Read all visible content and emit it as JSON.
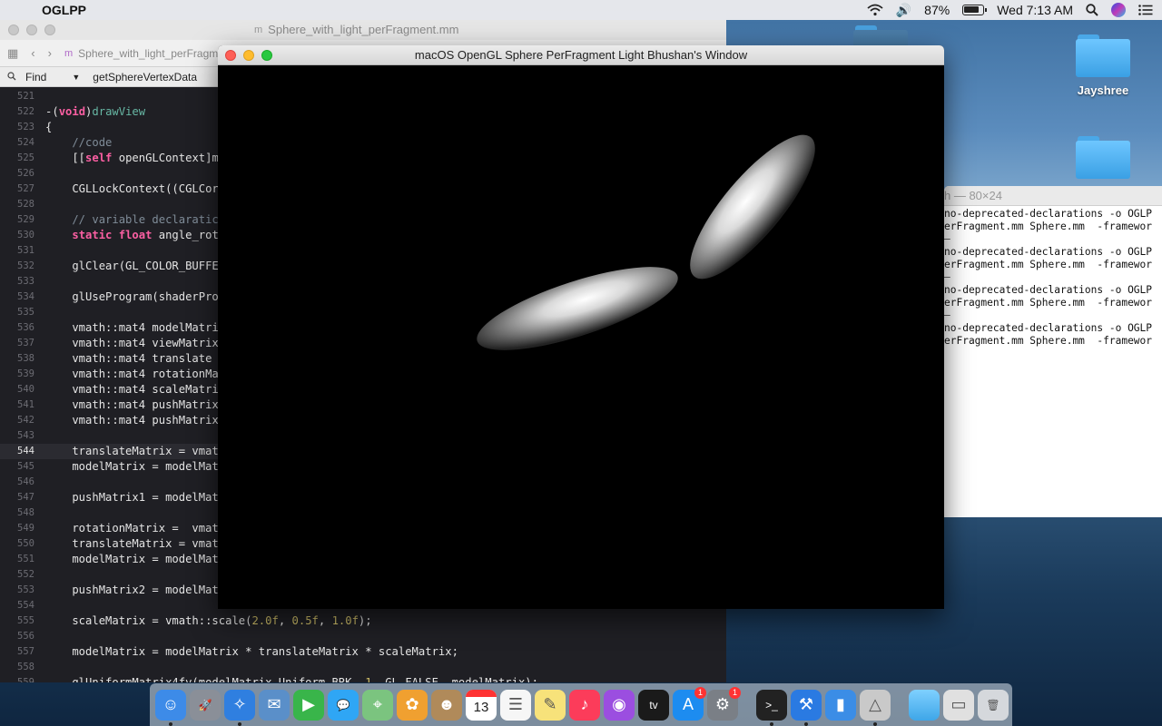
{
  "menubar": {
    "app_name": "OGLPP",
    "battery_percent": "87%",
    "clock": "Wed 7:13 AM"
  },
  "desktop": {
    "items": [
      {
        "label": "Jayshree"
      },
      {
        "label": ""
      },
      {
        "label": ""
      }
    ]
  },
  "xcode": {
    "title": "Sphere_with_light_perFragment.mm",
    "breadcrumb_file": "Sphere_with_light_perFragm",
    "find_mode": "Find",
    "find_query": "getSphereVertexData",
    "lines": [
      {
        "n": "521",
        "t": ""
      },
      {
        "n": "522",
        "t": "-(void)drawView"
      },
      {
        "n": "523",
        "t": "{"
      },
      {
        "n": "524",
        "t": "    //code"
      },
      {
        "n": "525",
        "t": "    [[self openGLContext]m"
      },
      {
        "n": "526",
        "t": ""
      },
      {
        "n": "527",
        "t": "    CGLLockContext((CGLCor"
      },
      {
        "n": "528",
        "t": ""
      },
      {
        "n": "529",
        "t": "    // variable declaratic"
      },
      {
        "n": "530",
        "t": "    static float angle_rot"
      },
      {
        "n": "531",
        "t": ""
      },
      {
        "n": "532",
        "t": "    glClear(GL_COLOR_BUFFE"
      },
      {
        "n": "533",
        "t": ""
      },
      {
        "n": "534",
        "t": "    glUseProgram(shaderPro"
      },
      {
        "n": "535",
        "t": ""
      },
      {
        "n": "536",
        "t": "    vmath::mat4 modelMatri"
      },
      {
        "n": "537",
        "t": "    vmath::mat4 viewMatrix"
      },
      {
        "n": "538",
        "t": "    vmath::mat4 translate"
      },
      {
        "n": "539",
        "t": "    vmath::mat4 rotationMa"
      },
      {
        "n": "540",
        "t": "    vmath::mat4 scaleMatri"
      },
      {
        "n": "541",
        "t": "    vmath::mat4 pushMatrix"
      },
      {
        "n": "542",
        "t": "    vmath::mat4 pushMatrix"
      },
      {
        "n": "543",
        "t": ""
      },
      {
        "n": "544",
        "t": "    translateMatrix = vmat"
      },
      {
        "n": "545",
        "t": "    modelMatrix = modelMat"
      },
      {
        "n": "546",
        "t": ""
      },
      {
        "n": "547",
        "t": "    pushMatrix1 = modelMat"
      },
      {
        "n": "548",
        "t": ""
      },
      {
        "n": "549",
        "t": "    rotationMatrix =  vmat"
      },
      {
        "n": "550",
        "t": "    translateMatrix = vmat"
      },
      {
        "n": "551",
        "t": "    modelMatrix = modelMat"
      },
      {
        "n": "552",
        "t": ""
      },
      {
        "n": "553",
        "t": "    pushMatrix2 = modelMat"
      },
      {
        "n": "554",
        "t": ""
      },
      {
        "n": "555",
        "t": "    scaleMatrix = vmath::scale(2.0f, 0.5f, 1.0f);"
      },
      {
        "n": "556",
        "t": ""
      },
      {
        "n": "557",
        "t": "    modelMatrix = modelMatrix * translateMatrix * scaleMatrix;"
      },
      {
        "n": "558",
        "t": ""
      },
      {
        "n": "559",
        "t": "    glUniformMatrix4fv(modelMatrix_Uniform_BRK, 1, GL_FALSE, modelMatrix);"
      }
    ],
    "current_line": "544"
  },
  "glwindow": {
    "title": "macOS OpenGL Sphere PerFragment Light Bhushan's Window"
  },
  "terminal": {
    "title": "h — 80×24",
    "lines": [
      "no-deprecated-declarations -o OGLP",
      "erFragment.mm Sphere.mm  -framewor",
      "",
      "no-deprecated-declarations -o OGLP",
      "erFragment.mm Sphere.mm  -framewor",
      "",
      "no-deprecated-declarations -o OGLP",
      "erFragment.mm Sphere.mm  -framewor",
      "",
      "no-deprecated-declarations -o OGLP",
      "erFragment.mm Sphere.mm  -framewor"
    ]
  },
  "dock": {
    "calendar_day": "13",
    "appstore_badge": "1",
    "prefs_badge": "1",
    "apps": [
      {
        "name": "finder-icon",
        "color": "#3d8be8",
        "glyph": "☺",
        "running": true
      },
      {
        "name": "launchpad-icon",
        "color": "#8a8f98",
        "glyph": "🚀",
        "running": false
      },
      {
        "name": "safari-icon",
        "color": "#2f7fe0",
        "glyph": "✧",
        "running": true
      },
      {
        "name": "preview-icon",
        "color": "#5a8fc9",
        "glyph": "✉",
        "running": false
      },
      {
        "name": "facetime-icon",
        "color": "#39b54a",
        "glyph": "▶",
        "running": false
      },
      {
        "name": "messages-icon",
        "color": "#2fa6f5",
        "glyph": "💬",
        "running": false
      },
      {
        "name": "maps-icon",
        "color": "#7bc47f",
        "glyph": "⌖",
        "running": false
      },
      {
        "name": "photos-icon",
        "color": "#f0a030",
        "glyph": "✿",
        "running": false
      },
      {
        "name": "contacts-icon",
        "color": "#b08a5a",
        "glyph": "☻",
        "running": false
      },
      {
        "name": "calendar-icon",
        "color": "#ffffff",
        "glyph": "",
        "running": false
      },
      {
        "name": "reminders-icon",
        "color": "#f6f6f6",
        "glyph": "☰",
        "running": false
      },
      {
        "name": "notes-icon",
        "color": "#f7e27a",
        "glyph": "✎",
        "running": false
      },
      {
        "name": "music-icon",
        "color": "#fc3c5a",
        "glyph": "♪",
        "running": false
      },
      {
        "name": "podcasts-icon",
        "color": "#9b4ee0",
        "glyph": "◉",
        "running": false
      },
      {
        "name": "tv-icon",
        "color": "#1a1a1a",
        "glyph": "tv",
        "running": false
      },
      {
        "name": "appstore-icon",
        "color": "#1d8cf0",
        "glyph": "A",
        "running": false
      },
      {
        "name": "system-preferences-icon",
        "color": "#7a7f86",
        "glyph": "⚙",
        "running": false
      },
      {
        "name": "terminal-icon",
        "color": "#222222",
        "glyph": ">_",
        "running": true
      },
      {
        "name": "xcode-icon",
        "color": "#2a7ae2",
        "glyph": "⚒",
        "running": true
      },
      {
        "name": "simulator-icon",
        "color": "#3b8de6",
        "glyph": "▮",
        "running": false
      },
      {
        "name": "instruments-icon",
        "color": "#c9c9c9",
        "glyph": "△",
        "running": true
      },
      {
        "name": "downloads-folder-icon",
        "color": "#5db9f5",
        "glyph": "",
        "running": false
      },
      {
        "name": "screenshot-icon",
        "color": "#e0e0e0",
        "glyph": "▭",
        "running": false
      },
      {
        "name": "trash-icon",
        "color": "#d5d8dc",
        "glyph": "🗑",
        "running": false
      }
    ]
  }
}
